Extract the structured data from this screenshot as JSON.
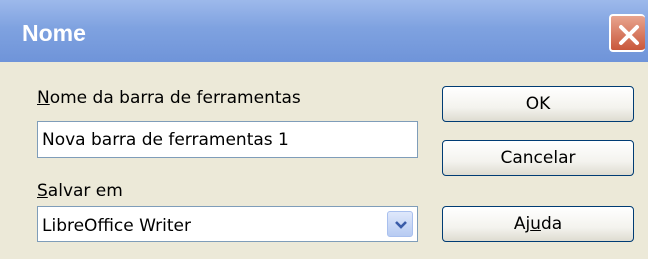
{
  "dialog": {
    "title": "Nome",
    "toolbar_name_label": {
      "first": "N",
      "rest": "ome da barra de ferramentas"
    },
    "toolbar_name_value": "Nova barra de ferramentas 1",
    "save_in_label": {
      "first": "S",
      "rest": "alvar em"
    },
    "save_in_value": "LibreOffice Writer",
    "ok_label": "OK",
    "cancel_label": "Cancelar",
    "help_label": {
      "pre": "Aj",
      "accel": "u",
      "post": "da"
    }
  },
  "icons": {
    "close": "close-icon",
    "dropdown": "chevron-down-icon"
  },
  "colors": {
    "titlebar": "#7fa2e0",
    "dialog_bg": "#ece9d8",
    "close": "#c9583c"
  }
}
